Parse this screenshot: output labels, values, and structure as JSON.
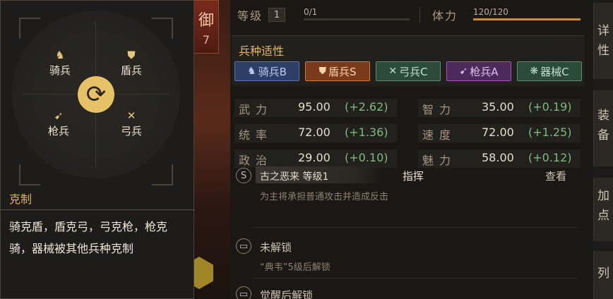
{
  "hero": {
    "defense_char": "御",
    "defense_value": "7"
  },
  "counter_panel": {
    "units": [
      {
        "label": "骑兵",
        "icon": "horse-icon",
        "glyph": "♞"
      },
      {
        "label": "盾兵",
        "icon": "shield-icon",
        "glyph": "⛊"
      },
      {
        "label": "枪兵",
        "icon": "spear-icon",
        "glyph": "➹"
      },
      {
        "label": "弓兵",
        "icon": "bow-icon",
        "glyph": "✕"
      }
    ],
    "cycle_glyph": "⟳",
    "title": "克制",
    "text": "骑克盾，盾克弓，弓克枪，枪克骑，器械被其他兵种克制"
  },
  "level": {
    "label": "等级",
    "value": "1",
    "exp_text": "0/1",
    "exp_fraction": 0
  },
  "stamina": {
    "label": "体力",
    "text": "120/120",
    "fraction": 1.0,
    "color": "#c98b3e"
  },
  "troop_fitness": {
    "title": "兵种适性",
    "badges": [
      {
        "label": "骑兵B",
        "icon": "horse-icon",
        "glyph": "♞",
        "bg": "#2e3f66",
        "border": "#5a72a8",
        "color": "#b9c8ec"
      },
      {
        "label": "盾兵S",
        "icon": "shield-icon",
        "glyph": "⛊",
        "bg": "#7a3b1c",
        "border": "#d07a3a",
        "color": "#ffd3a8"
      },
      {
        "label": "弓兵C",
        "icon": "bow-icon",
        "glyph": "✕",
        "bg": "#2b4a3a",
        "border": "#5d8c73",
        "color": "#bfe0cc"
      },
      {
        "label": "枪兵A",
        "icon": "spear-icon",
        "glyph": "➹",
        "bg": "#4d2a5c",
        "border": "#9a5ab8",
        "color": "#e2c0f0"
      },
      {
        "label": "器械C",
        "icon": "gear-icon",
        "glyph": "❋",
        "bg": "#2b4a3a",
        "border": "#5d8c73",
        "color": "#bfe0cc"
      }
    ]
  },
  "stats": [
    {
      "name": "武力",
      "value": "95.00",
      "bonus": "(+2.62)"
    },
    {
      "name": "智力",
      "value": "35.00",
      "bonus": "(+0.19)"
    },
    {
      "name": "统率",
      "value": "72.00",
      "bonus": "(+1.36)"
    },
    {
      "name": "速度",
      "value": "72.00",
      "bonus": "(+1.25)"
    },
    {
      "name": "政治",
      "value": "29.00",
      "bonus": "(+0.10)"
    },
    {
      "name": "魅力",
      "value": "58.00",
      "bonus": "(+0.12)"
    }
  ],
  "skills": {
    "skill1": {
      "badge": "S",
      "name": "古之恶来 等级1",
      "type": "指挥",
      "view": "查看",
      "desc": "为主将承担普通攻击并造成反击"
    },
    "locked1": {
      "title": "未解锁",
      "desc": "“典韦”5级后解锁"
    },
    "locked2": {
      "title": "觉醒后解锁"
    }
  },
  "side_tabs": [
    "详",
    "性",
    "装",
    "备",
    "加",
    "点",
    "列"
  ]
}
